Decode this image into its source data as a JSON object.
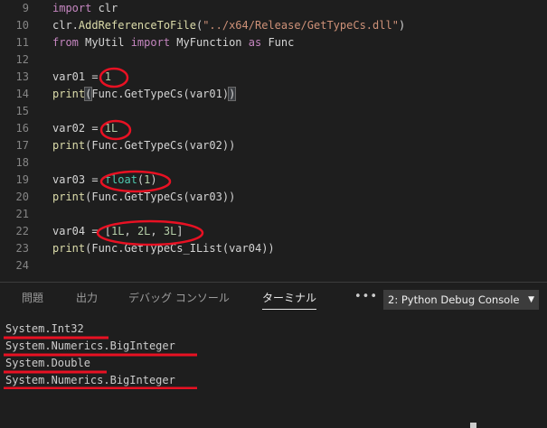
{
  "editor": {
    "lines": [
      {
        "n": "9",
        "tokens": [
          {
            "t": "import",
            "c": "kw"
          },
          {
            "t": " clr"
          }
        ]
      },
      {
        "n": "10",
        "tokens": [
          {
            "t": "clr."
          },
          {
            "t": "AddReferenceToFile",
            "c": "fn"
          },
          {
            "t": "("
          },
          {
            "t": "\"../x64/Release/GetTypeCs.dll\"",
            "c": "st"
          },
          {
            "t": ")"
          }
        ]
      },
      {
        "n": "11",
        "tokens": [
          {
            "t": "from",
            "c": "kw"
          },
          {
            "t": " MyUtil "
          },
          {
            "t": "import",
            "c": "kw"
          },
          {
            "t": " MyFunction "
          },
          {
            "t": "as",
            "c": "kw"
          },
          {
            "t": " Func"
          }
        ]
      },
      {
        "n": "12",
        "tokens": []
      },
      {
        "n": "13",
        "tokens": [
          {
            "t": "var01 = "
          },
          {
            "t": "1",
            "c": "nu"
          }
        ]
      },
      {
        "n": "14",
        "tokens": [
          {
            "t": "print",
            "c": "fn"
          },
          {
            "t": "(",
            "c": "sel"
          },
          {
            "t": "Func.GetTypeCs(var01)"
          },
          {
            "t": ")",
            "c": "sel"
          }
        ]
      },
      {
        "n": "15",
        "tokens": []
      },
      {
        "n": "16",
        "tokens": [
          {
            "t": "var02 = "
          },
          {
            "t": "1L",
            "c": "nu"
          }
        ]
      },
      {
        "n": "17",
        "tokens": [
          {
            "t": "print",
            "c": "fn"
          },
          {
            "t": "(Func.GetTypeCs(var02))"
          }
        ]
      },
      {
        "n": "18",
        "tokens": []
      },
      {
        "n": "19",
        "tokens": [
          {
            "t": "var03 = "
          },
          {
            "t": "float",
            "c": "bi"
          },
          {
            "t": "("
          },
          {
            "t": "1",
            "c": "nu"
          },
          {
            "t": ")"
          }
        ]
      },
      {
        "n": "20",
        "tokens": [
          {
            "t": "print",
            "c": "fn"
          },
          {
            "t": "(Func.GetTypeCs(var03))"
          }
        ]
      },
      {
        "n": "21",
        "tokens": []
      },
      {
        "n": "22",
        "tokens": [
          {
            "t": "var04 = ["
          },
          {
            "t": "1L",
            "c": "nu"
          },
          {
            "t": ", "
          },
          {
            "t": "2L",
            "c": "nu"
          },
          {
            "t": ", "
          },
          {
            "t": "3L",
            "c": "nu"
          },
          {
            "t": "]"
          }
        ]
      },
      {
        "n": "23",
        "tokens": [
          {
            "t": "print",
            "c": "fn"
          },
          {
            "t": "(Func.GetTypeCs_IList(var04))"
          }
        ]
      },
      {
        "n": "24",
        "tokens": []
      }
    ]
  },
  "panel": {
    "tabs": [
      "問題",
      "出力",
      "デバッグ コンソール",
      "ターミナル"
    ],
    "active_tab": "ターミナル",
    "more_label": "•••",
    "console_select": {
      "value": "2: Python Debug Console",
      "caret": "▼"
    }
  },
  "terminal": {
    "lines": [
      "System.Int32",
      "System.Numerics.BigInteger",
      "System.Double",
      "System.Numerics.BigInteger"
    ]
  },
  "colors": {
    "annotation": "#e81123",
    "editor_bg": "#1e1e1e",
    "keyword": "#c586c0",
    "function": "#dcdcaa",
    "string": "#ce9178",
    "number": "#b5cea8"
  }
}
